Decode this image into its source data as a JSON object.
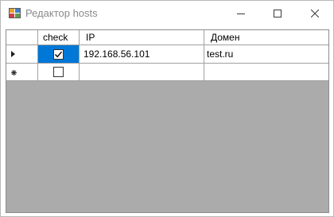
{
  "window": {
    "title": "Редактор hosts",
    "icon": "app-grid-icon",
    "controls": [
      "minimize-icon",
      "maximize-icon",
      "close-icon"
    ]
  },
  "grid": {
    "columns": [
      "check",
      "IP",
      "Домен"
    ],
    "rows": [
      {
        "checked": true,
        "ip": "192.168.56.101",
        "domain": "test.ru",
        "row_indicator": "current-row-arrow-icon",
        "selected_cell": "check"
      }
    ],
    "new_row": {
      "checked": false,
      "ip": "",
      "domain": "",
      "row_indicator": "new-row-asterisk-icon"
    }
  },
  "colors": {
    "selection": "#0078d7",
    "grid_background": "#ababab",
    "title_text": "#8a8a8a"
  }
}
